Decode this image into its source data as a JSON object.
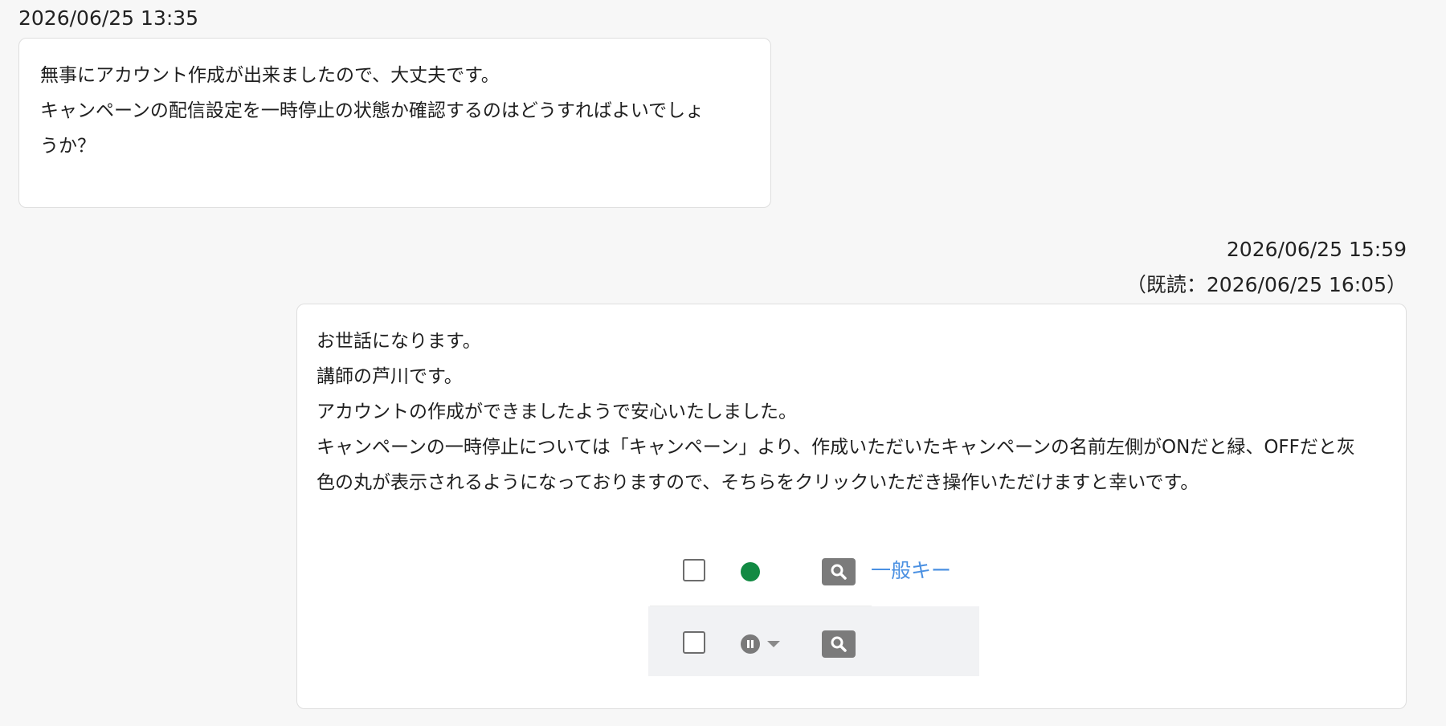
{
  "message1": {
    "timestamp": "2026/06/25 13:35",
    "lines": [
      "無事にアカウント作成が出来ましたので、大丈夫です。",
      "キャンペーンの配信設定を一時停止の状態か確認するのはどうすればよいでしょ",
      "うか？"
    ]
  },
  "message2": {
    "timestamp": "2026/06/25 15:59",
    "read_status": "（既読：2026/06/25 16:05）",
    "lines": [
      "お世話になります。",
      "講師の芦川です。",
      "アカウントの作成ができましたようで安心いたしました。",
      "キャンペーンの一時停止については「キャンペーン」より、作成いただいたキャンペーンの名前左側がONだと緑、OFFだと灰",
      "色の丸が表示されるようになっておりますので、そちらをクリックいただき操作いただけますと幸いです。"
    ],
    "screenshot": {
      "row1_keyword": "一般キー",
      "status_on_color": "#128a43",
      "status_off_color": "#7a7a7a",
      "link_color": "#4a90e2"
    }
  }
}
